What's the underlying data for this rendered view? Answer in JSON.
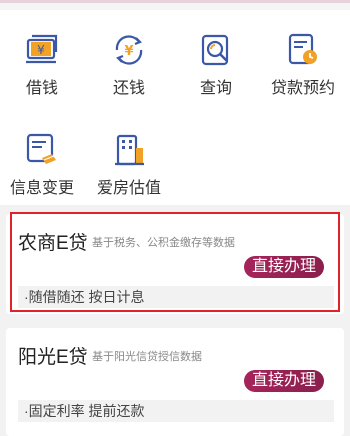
{
  "menu": {
    "items": [
      {
        "label": "借钱",
        "icon": "yen-card-icon"
      },
      {
        "label": "还钱",
        "icon": "yen-cycle-icon"
      },
      {
        "label": "查询",
        "icon": "search-doc-icon"
      },
      {
        "label": "贷款预约",
        "icon": "clock-doc-icon"
      },
      {
        "label": "信息变更",
        "icon": "edit-doc-icon"
      },
      {
        "label": "爱房估值",
        "icon": "building-icon"
      }
    ]
  },
  "products": [
    {
      "name": "农商E贷",
      "description": "基于税务、公积金缴存等数据",
      "button_label": "直接办理",
      "feature": "·随借随还 按日计息"
    },
    {
      "name": "阳光E贷",
      "description": "基于阳光信贷授信数据",
      "button_label": "直接办理",
      "feature": "·固定利率 提前还款"
    }
  ],
  "colors": {
    "icon_primary": "#3b58a8",
    "icon_accent": "#f2a127",
    "button_bg": "#9c2255",
    "highlight": "#e0232b"
  }
}
